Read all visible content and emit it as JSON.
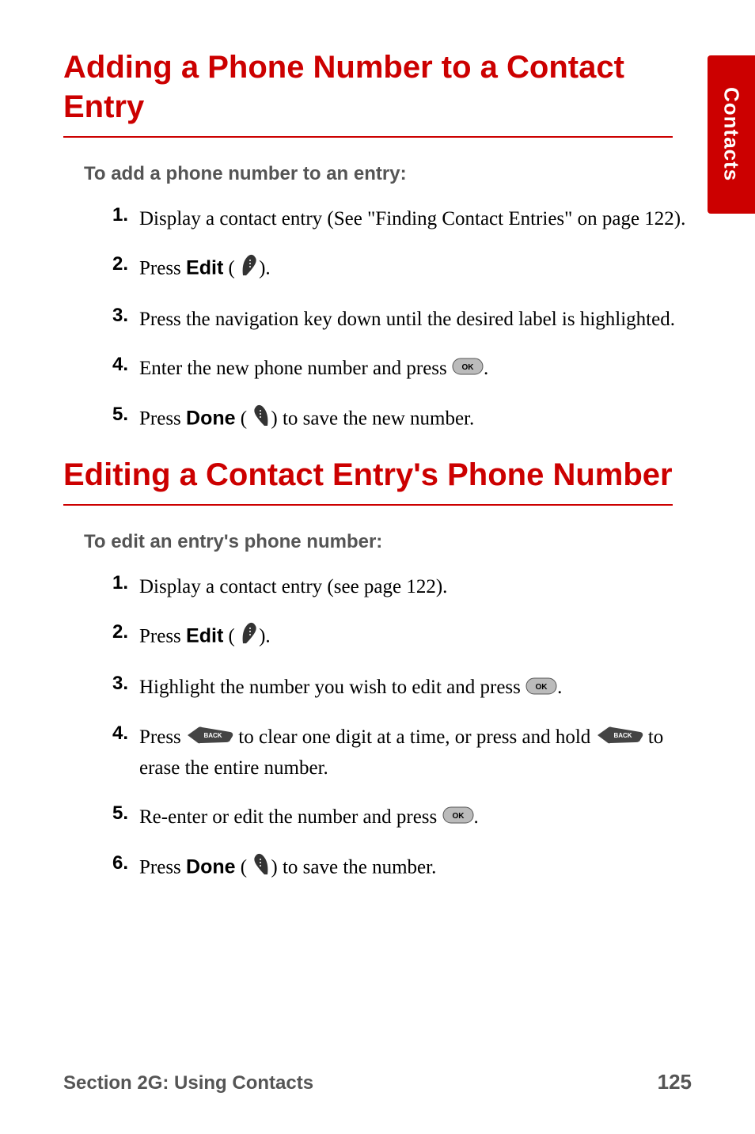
{
  "sideTab": "Contacts",
  "section1": {
    "title": "Adding a Phone Number to a Contact Entry",
    "lead": "To add a phone number to an entry:",
    "steps": [
      {
        "n": "1.",
        "pre": "Display a contact entry (See \"Finding Contact Entries\" on page 122)."
      },
      {
        "n": "2.",
        "pre": "Press ",
        "ui": "Edit",
        "post": " (",
        "tail": ")."
      },
      {
        "n": "3.",
        "pre": "Press the navigation key down until the desired label is highlighted."
      },
      {
        "n": "4.",
        "pre": "Enter the new phone number and press ",
        "tail": "."
      },
      {
        "n": "5.",
        "pre": "Press ",
        "ui": "Done",
        "post": " (",
        "tail": ") to save the new number."
      }
    ]
  },
  "section2": {
    "title": "Editing a Contact Entry's Phone Number",
    "lead": "To edit an entry's phone number:",
    "steps": [
      {
        "n": "1.",
        "pre": "Display a contact entry (see page 122)."
      },
      {
        "n": "2.",
        "pre": "Press ",
        "ui": "Edit",
        "post": " (",
        "tail": ")."
      },
      {
        "n": "3.",
        "pre": "Highlight the number you wish to edit and press ",
        "tail": "."
      },
      {
        "n": "4.",
        "pre": "Press ",
        "mid": " to clear one digit at a time, or press and hold ",
        "tail": " to erase the entire number."
      },
      {
        "n": "5.",
        "pre": "Re-enter or edit the number and press ",
        "tail": "."
      },
      {
        "n": "6.",
        "pre": "Press ",
        "ui": "Done",
        "post": " (",
        "tail": ") to save the number."
      }
    ]
  },
  "footer": {
    "section": "Section 2G: Using Contacts",
    "page": "125"
  },
  "icons": {
    "ok_label": "OK",
    "back_label": "BACK"
  }
}
